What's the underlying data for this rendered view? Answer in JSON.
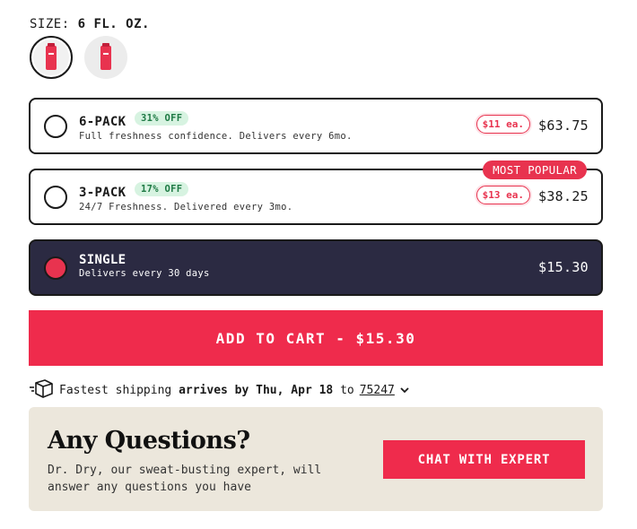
{
  "size": {
    "label": "SIZE:",
    "value": "6 FL. OZ."
  },
  "options": [
    {
      "title": "6-PACK",
      "discount": "31% OFF",
      "description": "Full freshness confidence. Delivers every 6mo.",
      "per_each": "$11 ea.",
      "price": "$63.75",
      "selected": false
    },
    {
      "title": "3-PACK",
      "discount": "17% OFF",
      "description": "24/7 Freshness. Delivered every 3mo.",
      "per_each": "$13 ea.",
      "price": "$38.25",
      "badge": "MOST POPULAR",
      "selected": false
    },
    {
      "title": "SINGLE",
      "description": "Delivers every 30 days",
      "price": "$15.30",
      "selected": true
    }
  ],
  "cart": {
    "label": "ADD TO CART - $15.30"
  },
  "shipping": {
    "prefix": "Fastest shipping",
    "bold": "arrives by Thu, Apr 18",
    "to": "to",
    "zip": "75247"
  },
  "questions": {
    "heading": "Any Questions?",
    "text": "Dr. Dry, our sweat-busting expert, will answer any questions you have",
    "button": "CHAT WITH EXPERT"
  },
  "colors": {
    "accent": "#ef2b4c",
    "dark": "#2b2a42",
    "green_badge": "#d7f3e1",
    "panel": "#ece7dc"
  },
  "icons": {
    "shipping": "truck-box-icon",
    "dropdown": "chevron-down-icon"
  }
}
